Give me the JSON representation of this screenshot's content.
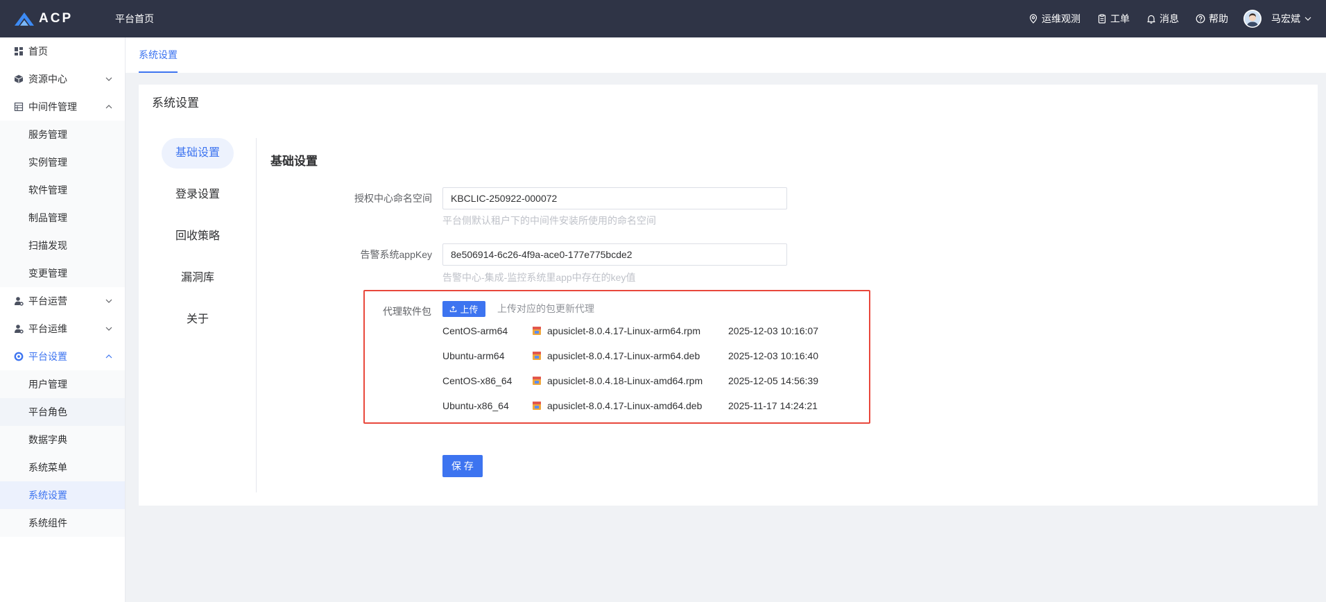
{
  "app": {
    "logo_text": "ACP"
  },
  "header": {
    "home_label": "平台首页",
    "nav": [
      {
        "label": "运维观测",
        "icon": "location-icon"
      },
      {
        "label": "工单",
        "icon": "clipboard-icon"
      },
      {
        "label": "消息",
        "icon": "bell-icon"
      },
      {
        "label": "帮助",
        "icon": "help-circle-icon"
      }
    ],
    "user_name": "马宏斌"
  },
  "sidebar": {
    "items": [
      {
        "label": "首页",
        "icon": "grid-icon"
      },
      {
        "label": "资源中心",
        "icon": "cube-icon",
        "expanded": false
      },
      {
        "label": "中间件管理",
        "icon": "server-icon",
        "expanded": true,
        "children": [
          {
            "label": "服务管理"
          },
          {
            "label": "实例管理"
          },
          {
            "label": "软件管理"
          },
          {
            "label": "制品管理"
          },
          {
            "label": "扫描发现"
          },
          {
            "label": "变更管理"
          }
        ]
      },
      {
        "label": "平台运营",
        "icon": "user-gear-icon",
        "expanded": false
      },
      {
        "label": "平台运维",
        "icon": "user-gear-icon",
        "expanded": false
      },
      {
        "label": "平台设置",
        "icon": "settings-icon",
        "expanded": true,
        "active": true,
        "children": [
          {
            "label": "用户管理"
          },
          {
            "label": "平台角色"
          },
          {
            "label": "数据字典"
          },
          {
            "label": "系统菜单"
          },
          {
            "label": "系统设置",
            "active": true
          },
          {
            "label": "系统组件"
          }
        ]
      }
    ]
  },
  "tabs": [
    {
      "label": "系统设置",
      "active": true
    }
  ],
  "page": {
    "title": "系统设置"
  },
  "settings_nav": [
    {
      "label": "基础设置",
      "active": true
    },
    {
      "label": "登录设置"
    },
    {
      "label": "回收策略"
    },
    {
      "label": "漏洞库"
    },
    {
      "label": "关于"
    }
  ],
  "basic": {
    "heading": "基础设置",
    "namespace": {
      "label": "授权中心命名空间",
      "value": "KBCLIC-250922-000072",
      "hint": "平台侧默认租户下的中间件安装所使用的命名空间"
    },
    "app_key": {
      "label": "告警系统appKey",
      "value": "8e506914-6c26-4f9a-ace0-177e775bcde2",
      "hint": "告警中心-集成-监控系统里app中存在的key值"
    },
    "agent_packages": {
      "label": "代理软件包",
      "upload_label": "上传",
      "upload_hint": "上传对应的包更新代理",
      "file_icon": "package-file-icon",
      "rows": [
        {
          "os": "CentOS-arm64",
          "file": "apusiclet-8.0.4.17-Linux-arm64.rpm",
          "uploaded": "2025-12-03 10:16:07"
        },
        {
          "os": "Ubuntu-arm64",
          "file": "apusiclet-8.0.4.17-Linux-arm64.deb",
          "uploaded": "2025-12-03 10:16:40"
        },
        {
          "os": "CentOS-x86_64",
          "file": "apusiclet-8.0.4.18-Linux-amd64.rpm",
          "uploaded": "2025-12-05 14:56:39"
        },
        {
          "os": "Ubuntu-x86_64",
          "file": "apusiclet-8.0.4.17-Linux-amd64.deb",
          "uploaded": "2025-11-17 14:24:21"
        }
      ]
    },
    "save_label": "保 存"
  },
  "colors": {
    "primary": "#3d74f0",
    "header_bg": "#2f3446",
    "highlight_border": "#e8473b"
  }
}
